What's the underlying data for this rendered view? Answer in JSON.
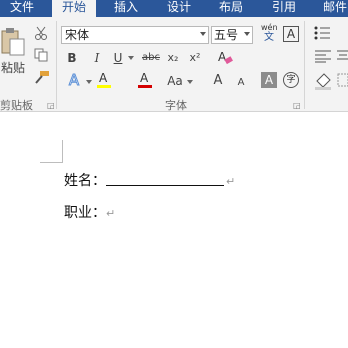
{
  "tabs": [
    "文件",
    "开始",
    "插入",
    "设计",
    "布局",
    "引用",
    "邮件"
  ],
  "clipboard": {
    "paste_label": "粘贴",
    "group_label": "剪贴板"
  },
  "font": {
    "name": "宋体",
    "size": "五号",
    "wen_label": "wén",
    "wen_char": "文",
    "group_label": "字体",
    "bold": "B",
    "italic": "I",
    "underline": "U",
    "strike": "abc",
    "subscript": "x₂",
    "superscript": "x²",
    "text_effect": "A",
    "highlight": "A",
    "font_color": "A",
    "change_case": "Aa",
    "grow": "A",
    "shrink": "A",
    "char_border": "A",
    "char_shade": "A",
    "enclose": "字"
  },
  "document": {
    "line1_label": "姓名：",
    "line2_label": "职业：",
    "return_mark": "↵"
  },
  "colors": {
    "ribbon_blue": "#2b579a",
    "ribbon_bg": "#f3f3f3",
    "text_effect_blue": "#5b8fd6",
    "highlight_yellow": "#ffff00",
    "font_red": "#d40000"
  }
}
